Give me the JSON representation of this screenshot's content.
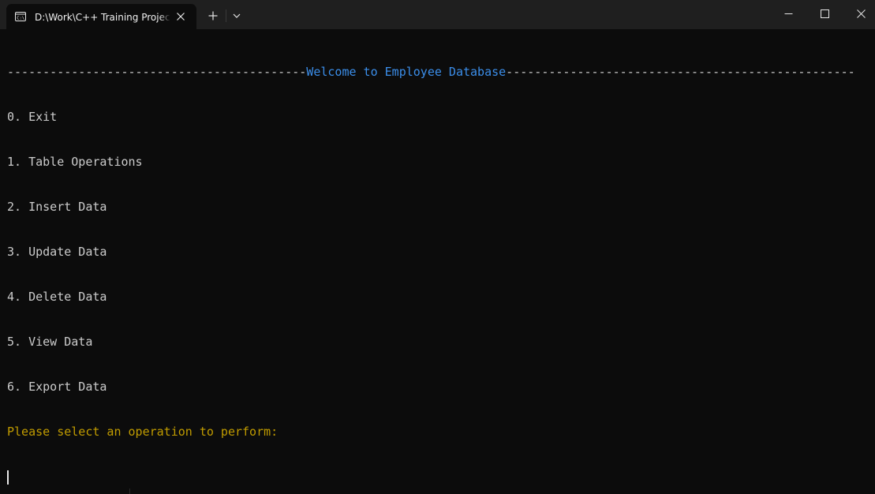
{
  "window": {
    "tab_title": "D:\\Work\\C++ Training Project",
    "tab_icon": "terminal-icon",
    "new_tab_icon": "plus-icon",
    "dropdown_icon": "chevron-down-icon",
    "minimize_icon": "minimize-icon",
    "maximize_icon": "maximize-icon",
    "close_icon": "close-icon"
  },
  "terminal": {
    "header": {
      "left": "------------------------------------------",
      "title": "Welcome to Employee Database",
      "right": "-------------------------------------------------"
    },
    "menu": [
      "0. Exit",
      "1. Table Operations",
      "2. Insert Data",
      "3. Update Data",
      "4. Delete Data",
      "5. View Data",
      "6. Export Data"
    ],
    "prompt": "Please select an operation to perform:"
  },
  "colors": {
    "background": "#0c0c0c",
    "titlebar": "#1f1f1f",
    "text": "#cccccc",
    "header_title": "#3b8eea",
    "prompt": "#c19c00"
  }
}
